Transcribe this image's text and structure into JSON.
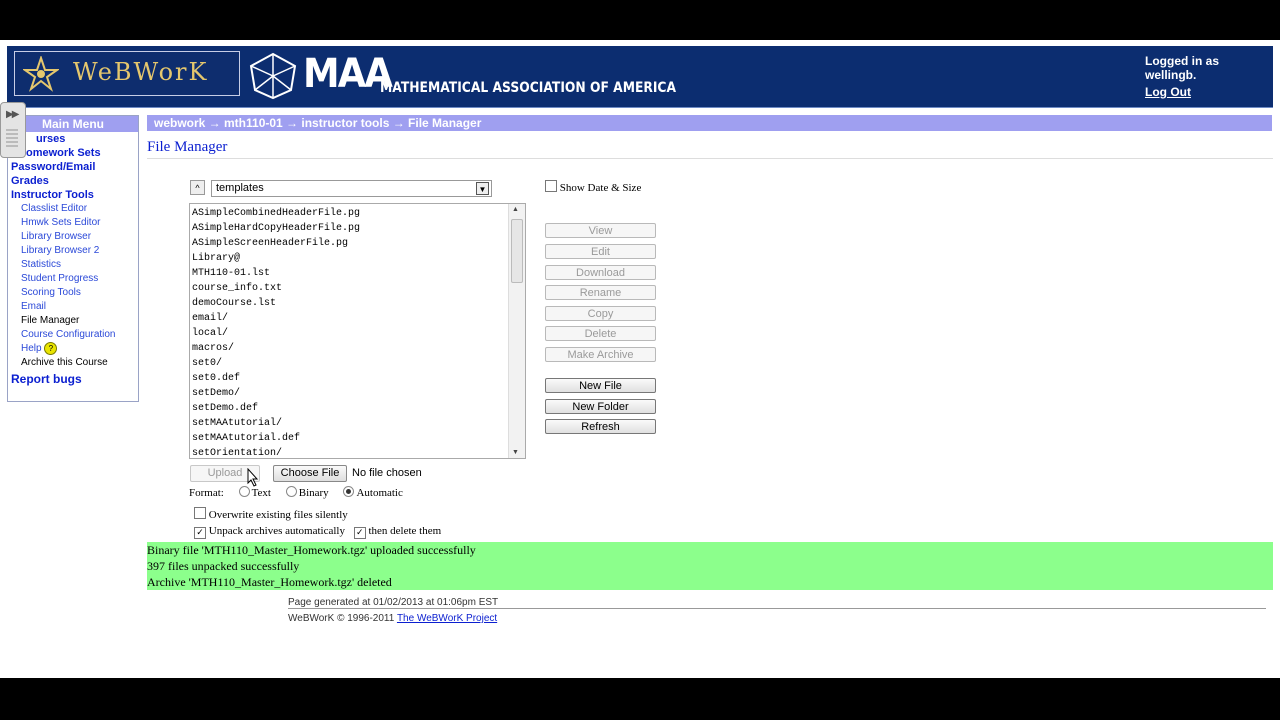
{
  "header": {
    "webwork_logo_text": "WeBWorK",
    "maa_abbrev": "MAA",
    "maa_full": "MATHEMATICAL ASSOCIATION OF AMERICA",
    "logged_in_text": "Logged in as wellingb.",
    "logout_label": "Log Out",
    "brand_color": "#0c2d70",
    "logo_text_color": "#e5c76d"
  },
  "menu": {
    "title": "Main Menu",
    "courses": "urses",
    "homework_sets": "omework Sets",
    "password_email": "Password/Email",
    "grades": "Grades",
    "instructor_tools": "Instructor Tools",
    "sub_items": {
      "classlist_editor": "Classlist Editor",
      "hmwk_sets_editor": "Hmwk Sets Editor",
      "library_browser": "Library Browser",
      "library_browser_2": "Library Browser 2",
      "statistics": "Statistics",
      "student_progress": "Student Progress",
      "scoring_tools": "Scoring Tools",
      "email": "Email",
      "file_manager": "File Manager",
      "course_configuration": "Course Configuration",
      "help": "Help",
      "archive_course": "Archive this Course"
    },
    "report_bugs": "Report bugs",
    "help_icon": "question-icon",
    "accent_color": "#9f9ff0"
  },
  "breadcrumb": "webwork → mth110-01 → instructor tools → File Manager",
  "page_title": "File Manager",
  "dir": {
    "up_label": "^",
    "current": "templates"
  },
  "show_date_label": "Show Date & Size",
  "files": [
    "ASimpleCombinedHeaderFile.pg",
    "ASimpleHardCopyHeaderFile.pg",
    "ASimpleScreenHeaderFile.pg",
    "Library@",
    "MTH110-01.lst",
    "course_info.txt",
    "demoCourse.lst",
    "email/",
    "local/",
    "macros/",
    "set0/",
    "set0.def",
    "setDemo/",
    "setDemo.def",
    "setMAAtutorial/",
    "setMAAtutorial.def",
    "setOrientation/"
  ],
  "actions": {
    "view": "View",
    "edit": "Edit",
    "download": "Download",
    "rename": "Rename",
    "copy": "Copy",
    "delete": "Delete",
    "make_archive": "Make Archive",
    "new_file": "New File",
    "new_folder": "New Folder",
    "refresh": "Refresh"
  },
  "upload": {
    "upload_label": "Upload",
    "choose_label": "Choose File",
    "no_file": "No file chosen",
    "format_label": "Format:",
    "format_text": "Text",
    "format_binary": "Binary",
    "format_automatic": "Automatic",
    "overwrite_label": "Overwrite existing files silently",
    "unpack_label": "Unpack archives automatically",
    "delete_label": "then delete them"
  },
  "messages": [
    "Binary file 'MTH110_Master_Homework.tgz' uploaded successfully",
    "397 files unpacked successfully",
    "Archive 'MTH110_Master_Homework.tgz' deleted"
  ],
  "message_color": "#8cff8c",
  "footer": {
    "generated": "Page generated at 01/02/2013 at 01:06pm EST",
    "copyright": "WeBWorK © 1996-2011",
    "project_link": "The WeBWorK Project"
  }
}
